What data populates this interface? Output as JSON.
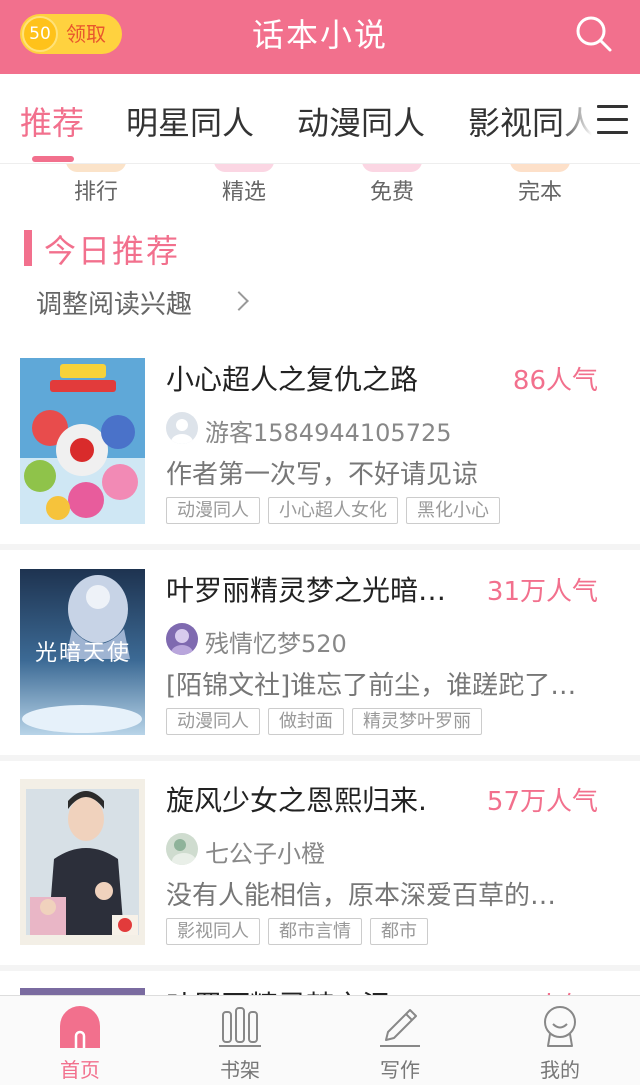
{
  "header": {
    "coin_count": "50",
    "claim_label": "领取",
    "title": "话本小说"
  },
  "tabs": [
    {
      "label": "推荐",
      "active": true
    },
    {
      "label": "明星同人",
      "active": false
    },
    {
      "label": "动漫同人",
      "active": false
    },
    {
      "label": "影视同人",
      "active": false
    }
  ],
  "categories": [
    {
      "label": "排行",
      "color": "#fbe3c9"
    },
    {
      "label": "精选",
      "color": "#fbd6e3"
    },
    {
      "label": "免费",
      "color": "#fbd6e3"
    },
    {
      "label": "完本",
      "color": "#fde0c9"
    }
  ],
  "section": {
    "title": "今日推荐",
    "adjust_label": "调整阅读兴趣"
  },
  "books": [
    {
      "title": "小心超人之复仇之路",
      "popularity": "86人气",
      "author": "游客1584944105725",
      "description": "作者第一次写，不好请见谅",
      "tags": [
        "动漫同人",
        "小心超人女化",
        "黑化小心"
      ]
    },
    {
      "title": "叶罗丽精灵梦之光暗…",
      "popularity": "31万人气",
      "author": "残情忆梦520",
      "description": "[陌锦文社]谁忘了前尘，谁蹉跎了…",
      "tags": [
        "动漫同人",
        "做封面",
        "精灵梦叶罗丽"
      ],
      "cover_text": "光暗天使"
    },
    {
      "title": "旋风少女之恩熙归来.",
      "popularity": "57万人气",
      "author": "七公子小橙",
      "description": "没有人能相信，原本深爱百草的…",
      "tags": [
        "影视同人",
        "都市言情",
        "都市"
      ]
    }
  ],
  "peek_book": {
    "title": "叶罗丽精灵梦之泪",
    "popularity": "万人气"
  },
  "bottom_nav": [
    {
      "label": "首页",
      "icon": "home-icon",
      "active": true
    },
    {
      "label": "书架",
      "icon": "bookshelf-icon",
      "active": false
    },
    {
      "label": "写作",
      "icon": "pencil-icon",
      "active": false
    },
    {
      "label": "我的",
      "icon": "profile-icon",
      "active": false
    }
  ],
  "colors": {
    "brand": "#f2708d",
    "coin": "#ffd23f"
  }
}
